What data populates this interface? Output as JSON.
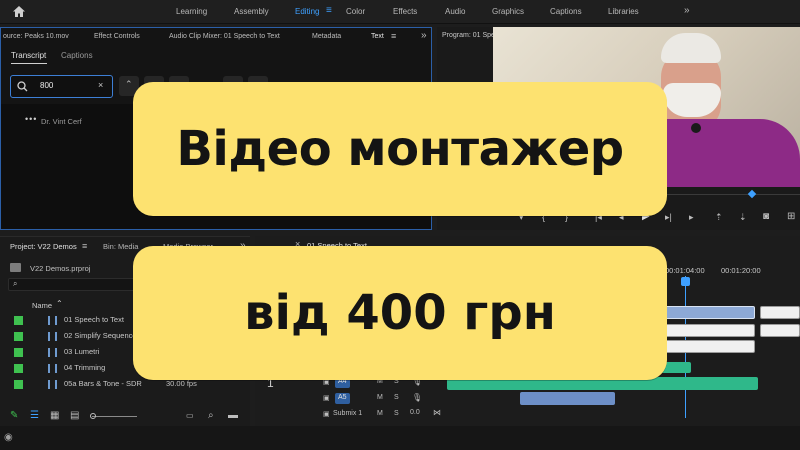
{
  "workspaces": {
    "items": [
      "Learning",
      "Assembly",
      "Editing",
      "Color",
      "Effects",
      "Audio",
      "Graphics",
      "Captions",
      "Libraries"
    ],
    "active": "Editing",
    "more": "»"
  },
  "source_panel": {
    "tabs": [
      "ource: Peaks 10.mov",
      "Effect Controls",
      "Audio Clip Mixer: 01 Speech to Text",
      "Metadata",
      "Text"
    ],
    "active_tab": "Text",
    "subtabs": [
      "Transcript",
      "Captions"
    ],
    "active_subtab": "Transcript",
    "search_value": "800",
    "speaker": "Dr. Vint Cerf",
    "more": "»"
  },
  "program_panel": {
    "title": "Program: 01 Spe"
  },
  "project_panel": {
    "tabs": [
      "Project: V22 Demos",
      "Bin: Media",
      "Media Browser"
    ],
    "file": "V22 Demos.prproj",
    "column_name": "Name",
    "items": [
      {
        "name": "01 Speech to Text",
        "rate": ""
      },
      {
        "name": "02 Simplify Sequence",
        "rate": ""
      },
      {
        "name": "03 Lumetri",
        "rate": ""
      },
      {
        "name": "04 Trimming",
        "rate": ""
      },
      {
        "name": "05a Bars & Tone - SDR",
        "rate": "30.00 fps"
      }
    ],
    "swatch_color": "#3fc150",
    "more": "»"
  },
  "timeline": {
    "tab": "01 Speech to Text",
    "timecodes": [
      "00:01:04:00",
      "00:01:20:00"
    ],
    "tracks": [
      "A4",
      "A5",
      "Submix 1"
    ],
    "track_controls": [
      "M",
      "S"
    ],
    "submix_value": "0.0",
    "track_number": "1"
  },
  "promo": {
    "title": "Відео монтажер",
    "price": "від 400 грн",
    "color": "#fde270"
  },
  "colors": {
    "accent": "#3ea0ff",
    "panel_border": "#2b5fa8",
    "audio_clip": "#2fb88a",
    "video_clip": "#6d8fc7"
  }
}
